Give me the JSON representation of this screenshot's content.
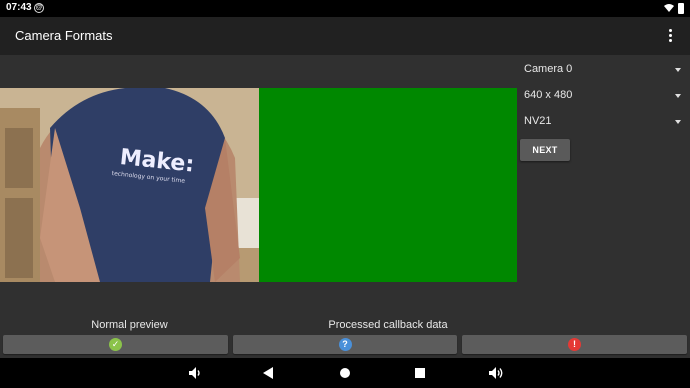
{
  "status_bar": {
    "time": "07:43",
    "notification_icon": "at-sign-icon",
    "wifi_icon": "wifi-icon",
    "battery_icon": "battery-icon"
  },
  "app_bar": {
    "title": "Camera Formats",
    "menu_icon": "overflow-menu-icon"
  },
  "controls": {
    "camera": "Camera 0",
    "resolution": "640 x 480",
    "format": "NV21",
    "next_label": "NEXT"
  },
  "previews": {
    "normal_caption": "Normal preview",
    "processed_caption": "Processed callback data"
  },
  "status_buttons": [
    {
      "icon": "check-icon",
      "symbol": "✓",
      "color": "#8bc34a"
    },
    {
      "icon": "question-icon",
      "symbol": "?",
      "color": "#4a90d9"
    },
    {
      "icon": "error-icon",
      "symbol": "!",
      "color": "#e53935"
    }
  ],
  "nav_bar": {
    "icons": [
      "volume-down-icon",
      "back-icon",
      "home-icon",
      "recents-icon",
      "volume-up-icon"
    ]
  },
  "colors": {
    "processed_preview": "#008800",
    "background": "#303030",
    "app_bar": "#212121"
  }
}
